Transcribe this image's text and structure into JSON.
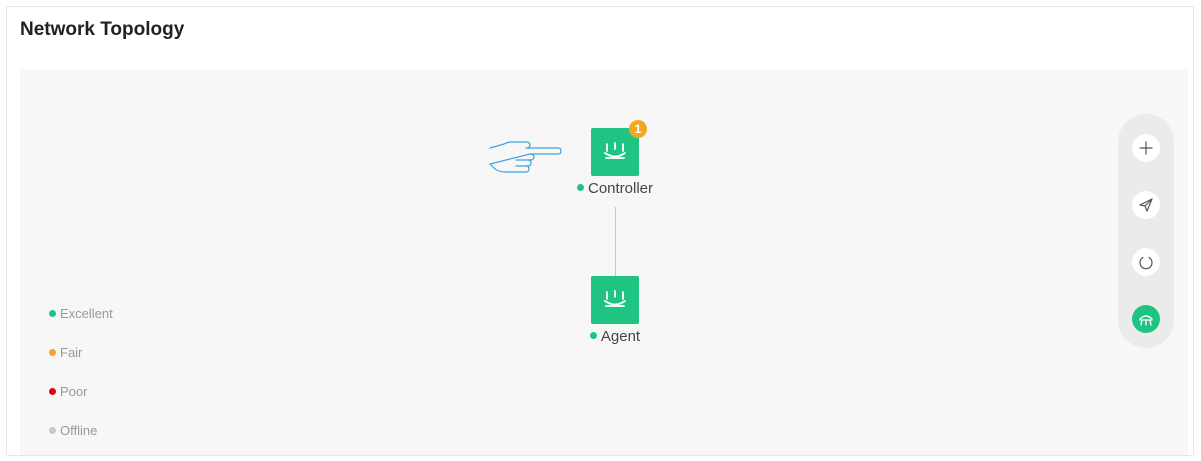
{
  "header": {
    "title": "Network Topology"
  },
  "legend": [
    {
      "label": "Excellent",
      "color": "#1fc483"
    },
    {
      "label": "Fair",
      "color": "#f5a623"
    },
    {
      "label": "Poor",
      "color": "#e60012"
    },
    {
      "label": "Offline",
      "color": "#c8c8c8"
    }
  ],
  "nodes": {
    "controller": {
      "label": "Controller",
      "badge": "1",
      "status_color": "#1fc483"
    },
    "agent": {
      "label": "Agent",
      "status_color": "#1fc483"
    }
  },
  "toolbar": {
    "buttons": [
      {
        "icon": "plus-icon"
      },
      {
        "icon": "send-icon"
      },
      {
        "icon": "power-icon"
      },
      {
        "icon": "mesh-router-icon",
        "active": true
      }
    ]
  },
  "colors": {
    "accent": "#1fc483",
    "badge": "#f5a623"
  }
}
